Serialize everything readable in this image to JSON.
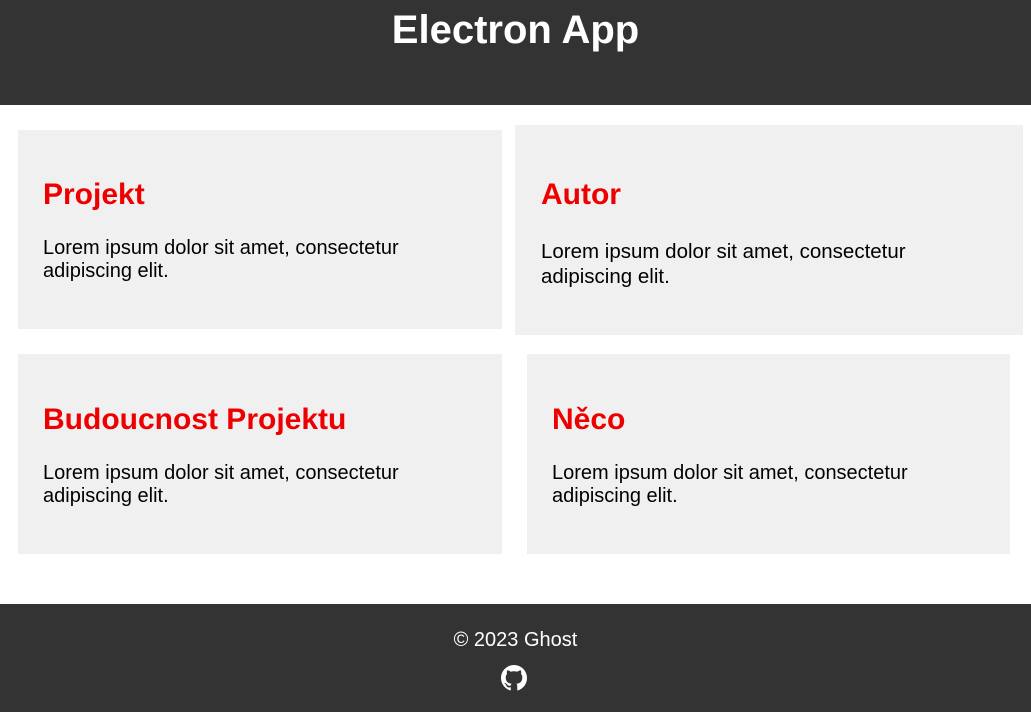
{
  "header": {
    "title": "Electron App"
  },
  "cards": [
    {
      "title": "Projekt",
      "text": "Lorem ipsum dolor sit amet, consectetur adipiscing elit."
    },
    {
      "title": "Autor",
      "text": "Lorem ipsum dolor sit amet, consectetur adipiscing elit."
    },
    {
      "title": "Budoucnost Projektu",
      "text": "Lorem ipsum dolor sit amet, consectetur adipiscing elit."
    },
    {
      "title": "Něco",
      "text": "Lorem ipsum dolor sit amet, consectetur adipiscing elit."
    }
  ],
  "footer": {
    "copyright": "© 2023 Ghost",
    "icon": "github-icon"
  },
  "colors": {
    "header_bg": "#333333",
    "footer_bg": "#333333",
    "card_bg": "#f0f0f0",
    "card_title": "#ee0000",
    "text": "#000000"
  }
}
